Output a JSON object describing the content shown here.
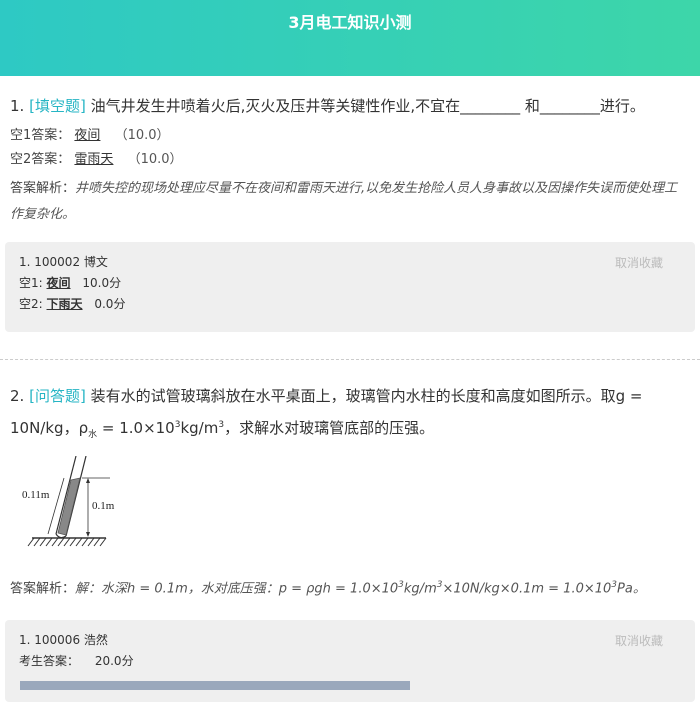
{
  "header": {
    "title": "3月电工知识小测"
  },
  "q1": {
    "number": "1.",
    "type": "[填空题]",
    "text": "油气井发生井喷着火后,灭火及压井等关键性作业,不宜在________ 和________进行。",
    "answers": [
      {
        "label": "空1答案：",
        "value": "夜间",
        "score": "（10.0）"
      },
      {
        "label": "空2答案：",
        "value": "雷雨天",
        "score": "（10.0）"
      }
    ],
    "analysis_label": "答案解析：",
    "analysis_text": "井喷失控的现场处理应尽量不在夜间和雷雨天进行,以免发生抢险人员人身事故以及因操作失误而使处理工作复杂化。",
    "card": {
      "user": "1. 100002 博文",
      "cancel": "取消收藏",
      "rows": [
        {
          "label": "空1:",
          "value": "夜间",
          "score": "10.0分"
        },
        {
          "label": "空2:",
          "value": "下雨天",
          "score": "0.0分"
        }
      ]
    }
  },
  "q2": {
    "number": "2.",
    "type": "[问答题]",
    "text_part1": "装有水的试管玻璃斜放在水平桌面上，玻璃管内水柱的长度和高度如图所示。取g = 10N/kg，ρ",
    "rho_sub": "水",
    "text_part2": " = 1.0×10",
    "exp1": "3",
    "text_part3": "kg/m",
    "exp2": "3",
    "text_part4": "，求解水对玻璃管底部的压强。",
    "figure": {
      "label_length": "0.11m",
      "label_height": "0.1m"
    },
    "analysis_label": "答案解析：",
    "analysis_a": "解：水深h = 0.1m，水对底压强：p = ρgh = 1.0×10",
    "analysis_exp1": "3",
    "analysis_b": "kg/m",
    "analysis_exp2": "3",
    "analysis_c": "×10N/kg×0.1m = 1.0×10",
    "analysis_exp3": "3",
    "analysis_d": "Pa。",
    "card": {
      "user": "1. 100006 浩然",
      "cancel": "取消收藏",
      "label": "考生答案：",
      "score": "20.0分"
    }
  }
}
